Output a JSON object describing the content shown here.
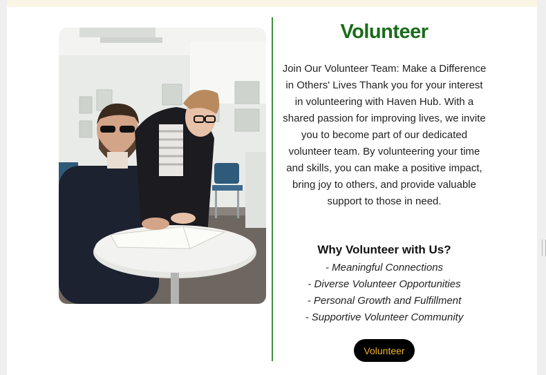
{
  "section": {
    "title": "Volunteer",
    "intro": "Join Our Volunteer Team: Make a Difference in Others' Lives Thank you for your interest in volunteering with Haven Hub. With a shared passion for improving lives, we invite you to become part of our dedicated volunteer team. By volunteering your time and skills, you can make a positive impact, bring joy to others, and provide valuable support to those in need.",
    "why_heading": "Why Volunteer with Us?",
    "benefits": [
      "- Meaningful Connections",
      "- Diverse Volunteer Opportunities",
      "- Personal Growth and Fulfillment",
      "- Supportive Volunteer Community"
    ],
    "button_label": "Volunteer"
  },
  "colors": {
    "title_green": "#1a6b1a",
    "divider_green": "#3f8f3f",
    "button_bg": "#000000",
    "button_text": "#f0b429",
    "top_band": "#fbf5e6"
  },
  "icons": {
    "scroll_handle": "resize-handle-icon"
  }
}
